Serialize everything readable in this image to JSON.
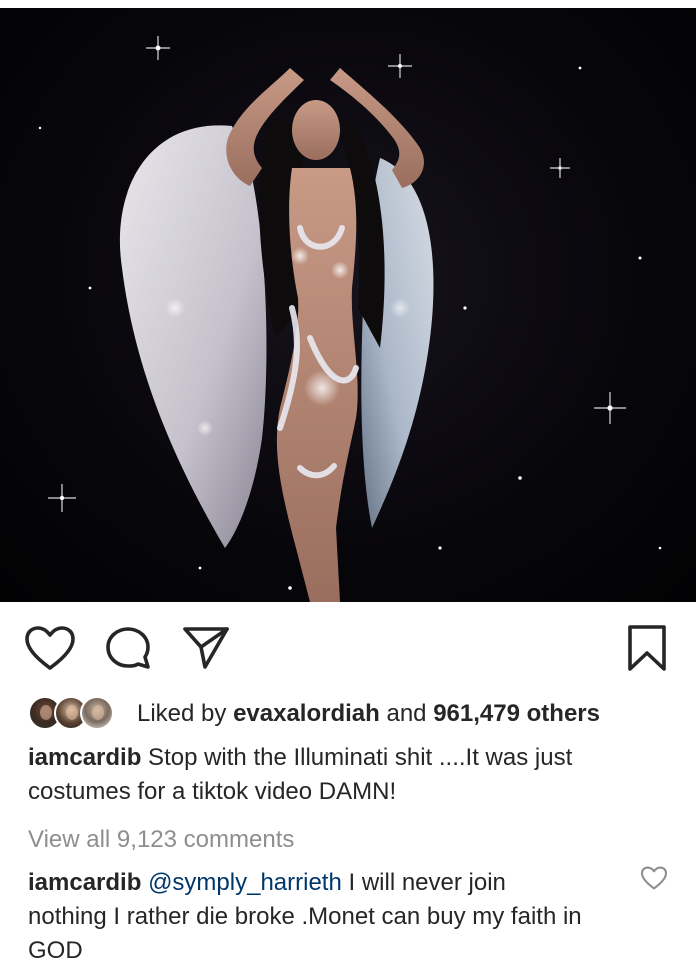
{
  "post": {
    "image_alt": "Woman with white angel wings in a jeweled outfit against a starry black background"
  },
  "actions": {
    "like_icon": "heart-outline-icon",
    "comment_icon": "comment-bubble-icon",
    "share_icon": "paper-plane-icon",
    "save_icon": "bookmark-icon"
  },
  "likes": {
    "prefix": "Liked by ",
    "user": "evaxalordiah",
    "middle": " and ",
    "count": "961,479 others"
  },
  "caption": {
    "username": "iamcardib",
    "text": " Stop with the Illuminati shit ....It was just costumes for a tiktok video DAMN!"
  },
  "view_comments": "View all 9,123 comments",
  "comment": {
    "username": "iamcardib",
    "mention": "@symply_harrieth",
    "text": " I will never join nothing I rather die broke .Monet can buy my faith in GOD"
  },
  "colors": {
    "text": "#262626",
    "muted": "#8e8e8e",
    "mention": "#00376b",
    "background": "#ffffff"
  }
}
